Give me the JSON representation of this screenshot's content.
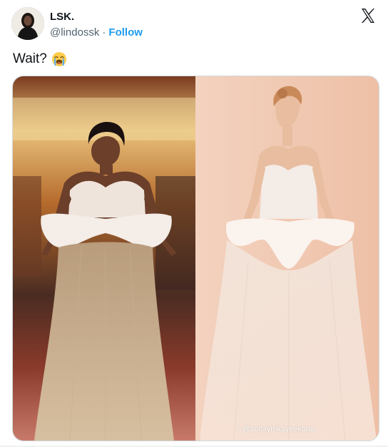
{
  "user": {
    "display_name": "LSK.",
    "handle": "@lindossk",
    "separator": "·",
    "follow_label": "Follow"
  },
  "tweet": {
    "text": "Wait?",
    "emoji": "loudly-crying-face-emoji"
  },
  "media": {
    "watermark": "@sollaymkaykekana",
    "watermark_icon": "tiktok-icon"
  },
  "icons": {
    "brand": "x-logo-icon"
  },
  "colors": {
    "accent": "#1d9bf0",
    "text": "#0f1419",
    "muted": "#536471",
    "border": "#cfd9de"
  }
}
